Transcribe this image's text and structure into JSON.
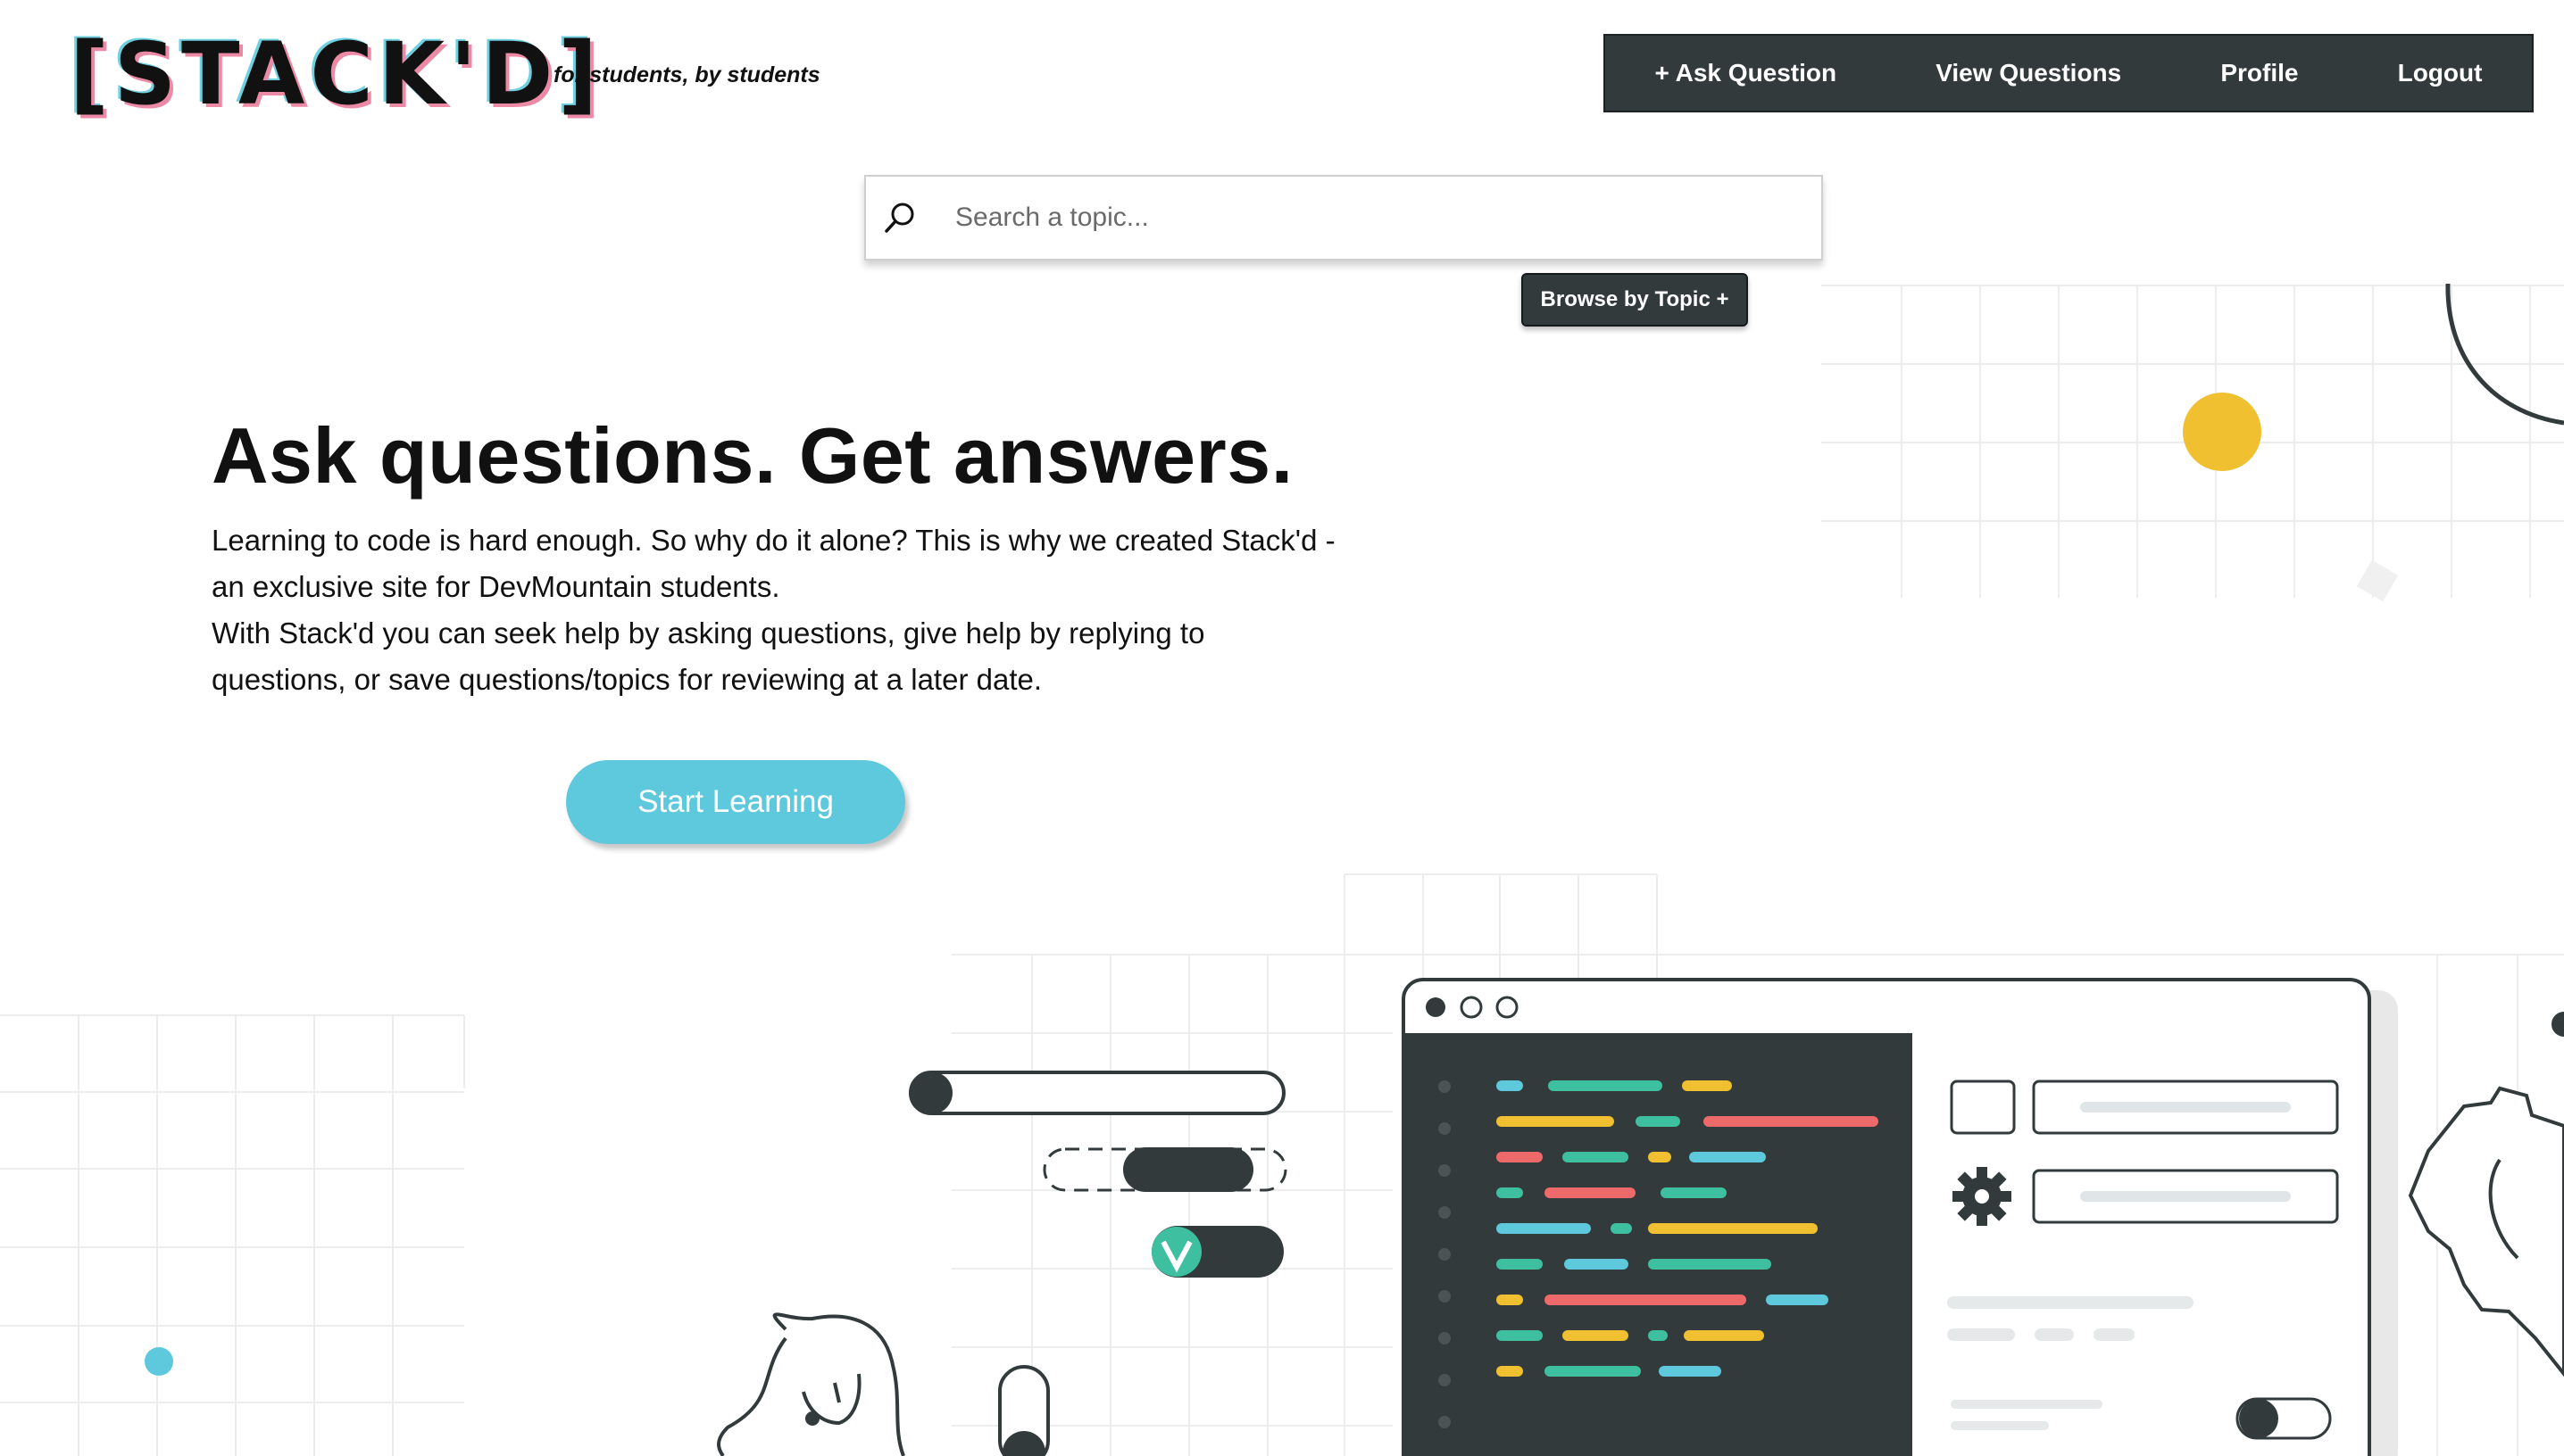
{
  "brand": {
    "logo": "[STACK'D]",
    "tagline": "for students, by students"
  },
  "nav": {
    "ask": "+ Ask Question",
    "view": "View Questions",
    "profile": "Profile",
    "logout": "Logout"
  },
  "search": {
    "placeholder": "Search a topic...",
    "value": "",
    "icon": "search-icon"
  },
  "browse": {
    "label": "Browse by Topic +"
  },
  "hero": {
    "title": "Ask questions. Get answers.",
    "paragraph1": "Learning to code is hard enough. So why do it alone? This is why we created Stack'd - an exclusive site for DevMountain students.",
    "paragraph2": "With Stack'd you can seek help by asking questions, give help by replying to questions, or save questions/topics for reviewing at a later date.",
    "cta": "Start Learning"
  },
  "colors": {
    "navbar": "#323a3c",
    "accent_cyan": "#5ec8dc",
    "yellow": "#f0c030",
    "teal": "#3dbfa0",
    "red": "#ee6a6a",
    "blue": "#5ec8dc",
    "editor_bg": "#323a3c"
  }
}
